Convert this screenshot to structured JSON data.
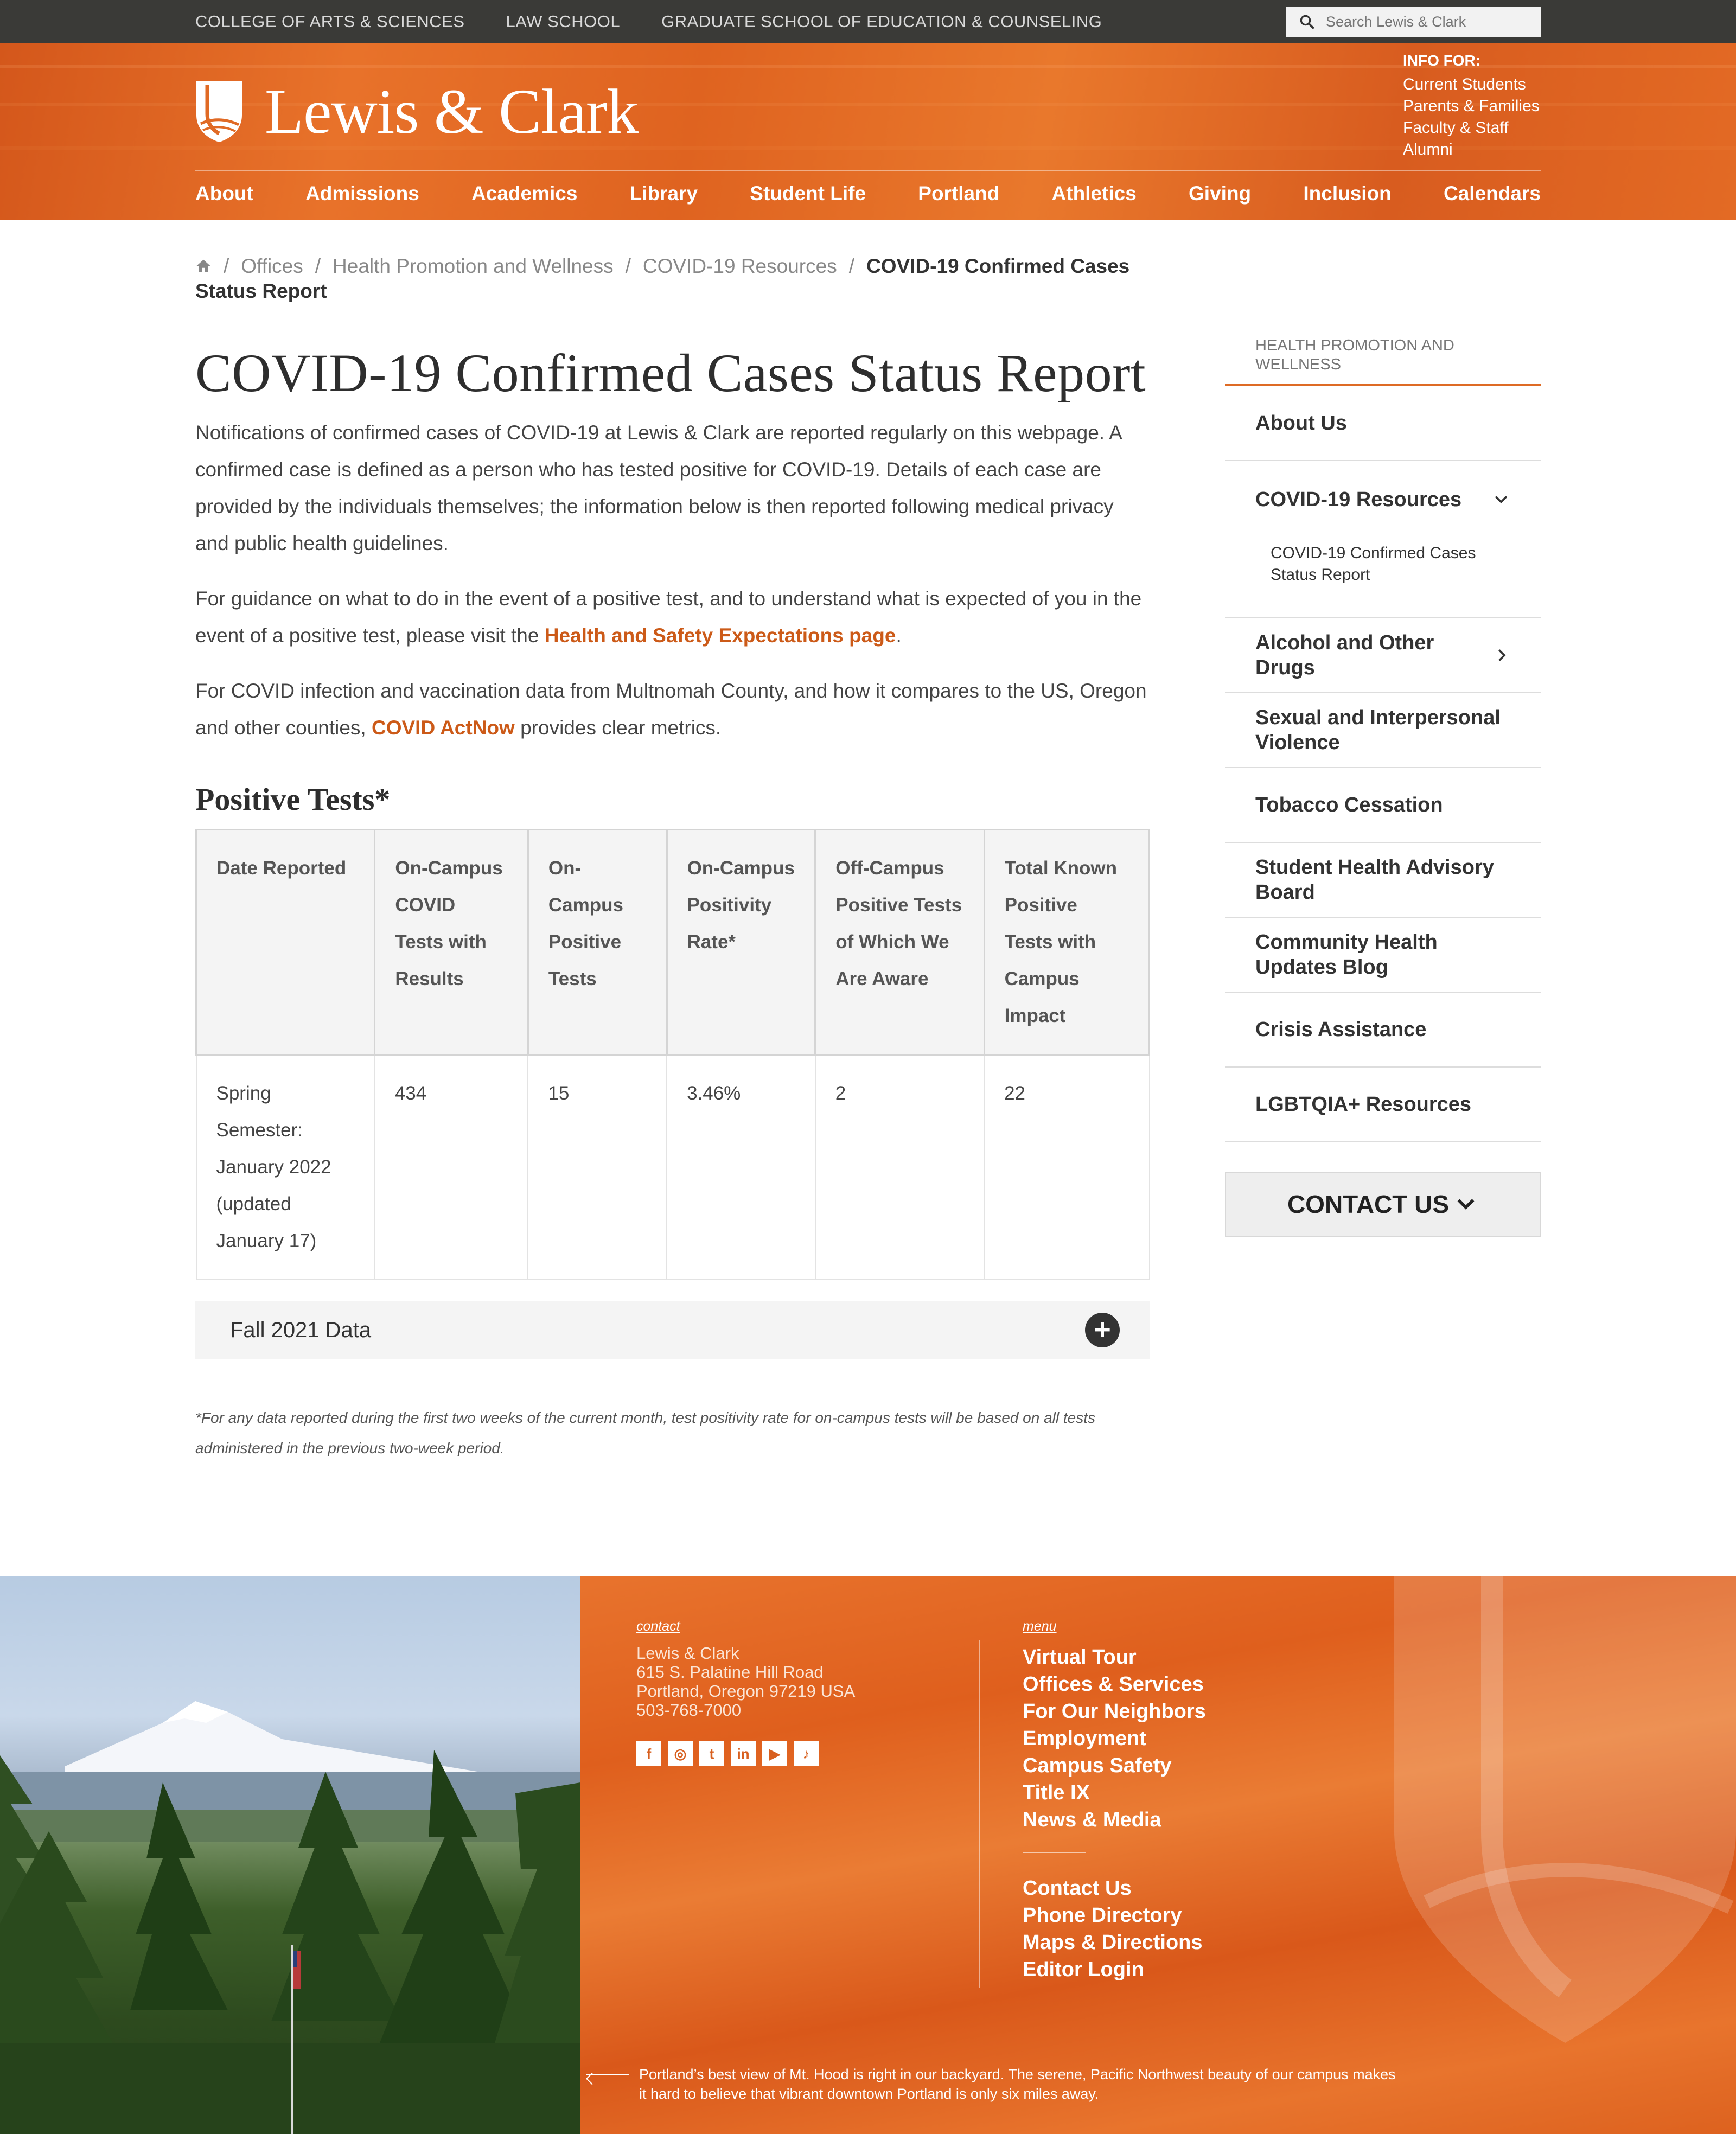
{
  "utility": {
    "links": [
      "COLLEGE OF ARTS & SCIENCES",
      "LAW SCHOOL",
      "GRADUATE SCHOOL OF EDUCATION & COUNSELING"
    ],
    "search_placeholder": "Search Lewis & Clark"
  },
  "header": {
    "logo_text": "Lewis & Clark",
    "info_for_label": "INFO FOR:",
    "info_for_links": [
      "Current Students",
      "Parents & Families",
      "Faculty & Staff",
      "Alumni"
    ],
    "nav": [
      "About",
      "Admissions",
      "Academics",
      "Library",
      "Student Life",
      "Portland",
      "Athletics",
      "Giving",
      "Inclusion",
      "Calendars"
    ]
  },
  "breadcrumb": {
    "items": [
      "Offices",
      "Health Promotion and Wellness",
      "COVID-19 Resources"
    ],
    "current": "COVID-19 Confirmed Cases Status Report"
  },
  "main": {
    "title": "COVID-19 Confirmed Cases Status Report",
    "intro": "Notifications of confirmed cases of COVID-19 at Lewis & Clark are reported regularly on this webpage. A confirmed case is defined as a person who has tested positive for COVID-19. Details of each case are provided by the individuals themselves; the information below is then reported following medical privacy and public health guidelines.",
    "guidance_before": "For guidance on what to do in the event of a positive test, and to understand what is expected of you in the event of a positive test, please visit the ",
    "guidance_link": "Health and Safety Expectations page",
    "guidance_after": ".",
    "county_before": "For COVID infection and vaccination data from Multnomah County, and how it compares to the US, Oregon and other counties, ",
    "county_link": "COVID ActNow",
    "county_after": " provides clear metrics.",
    "section_title": "Positive Tests*",
    "table": {
      "headers": [
        "Date Reported",
        "On-Campus COVID Tests with Results",
        "On-Campus Positive Tests",
        "On-Campus Positivity Rate*",
        "Off-Campus Positive Tests of Which We Are Aware",
        "Total Known Positive Tests with Campus Impact"
      ],
      "rows": [
        [
          "Spring Semester: January 2022 (updated January 17)",
          "434",
          "15",
          "3.46%",
          "2",
          "22"
        ]
      ]
    },
    "accordion_label": "Fall 2021 Data",
    "footnote": "*For any data reported during the first two weeks of the current month, test positivity rate for on-campus tests will be based on all tests administered in the previous two-week period."
  },
  "sidebar": {
    "heading": "HEALTH PROMOTION AND WELLNESS",
    "items": [
      "About Us",
      "COVID-19 Resources",
      "Alcohol and Other Drugs",
      "Sexual and Interpersonal Violence",
      "Tobacco Cessation",
      "Student Health Advisory Board",
      "Community Health Updates Blog",
      "Crisis Assistance",
      "LGBTQIA+ Resources"
    ],
    "sub_item": "COVID-19 Confirmed Cases Status Report",
    "contact_label": "CONTACT US"
  },
  "footer": {
    "contact_label": "contact",
    "address": [
      "Lewis & Clark",
      "615 S. Palatine Hill Road",
      "Portland, Oregon 97219 USA",
      "503-768-7000"
    ],
    "social_icons": [
      "facebook-icon",
      "instagram-icon",
      "twitter-icon",
      "linkedin-icon",
      "youtube-icon",
      "tiktok-icon"
    ],
    "menu_label": "menu",
    "menu_primary": [
      "Virtual Tour",
      "Offices & Services",
      "For Our Neighbors",
      "Employment",
      "Campus Safety",
      "Title IX",
      "News & Media"
    ],
    "menu_secondary": [
      "Contact Us",
      "Phone Directory",
      "Maps & Directions",
      "Editor Login"
    ],
    "caption": "Portland’s best view of Mt. Hood is right in our backyard. The serene, Pacific Northwest beauty of our campus makes it hard to believe that vibrant downtown Portland is only six miles away."
  }
}
